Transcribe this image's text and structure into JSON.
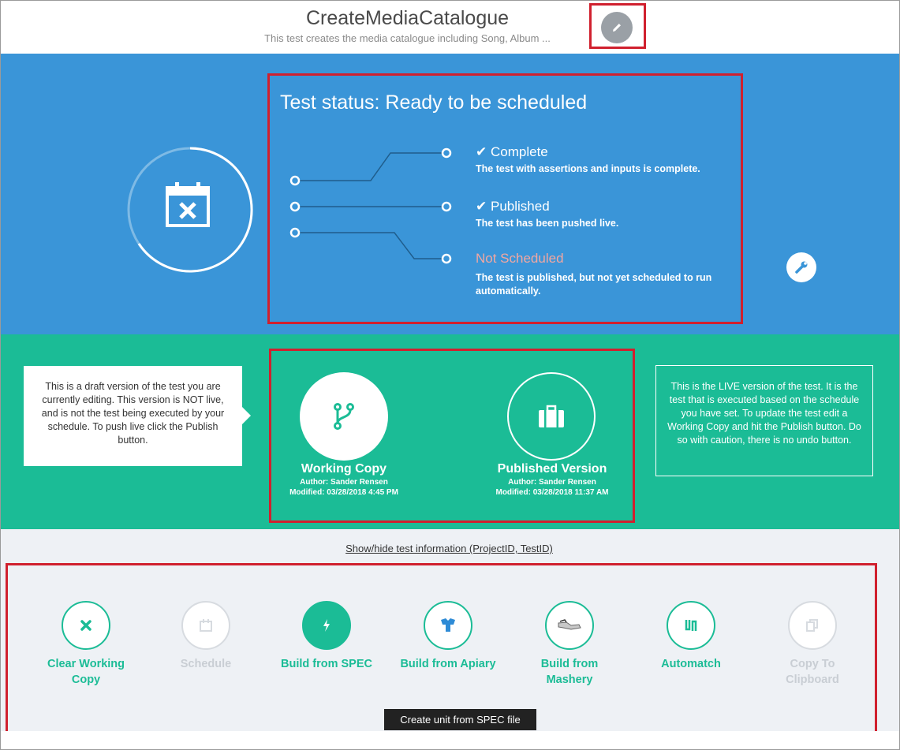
{
  "header": {
    "title": "CreateMediaCatalogue",
    "subtitle": "This test creates the media catalogue including Song, Album ..."
  },
  "status": {
    "title": "Test status: Ready to be scheduled",
    "steps": [
      {
        "label": "Complete",
        "desc": "The test with assertions and inputs is complete.",
        "checked": true
      },
      {
        "label": "Published",
        "desc": "The test has been pushed live.",
        "checked": true
      },
      {
        "label": "Not Scheduled",
        "desc1": "The test is published, but not yet scheduled to run",
        "desc2": "automatically.",
        "checked": false
      }
    ],
    "check_glyph": "✔",
    "colors": {
      "band": "#3a95d8",
      "warn": "#f2a7a1"
    }
  },
  "versions": {
    "draft_note": "This is a draft version of the test you are currently editing. This version is NOT live, and is not the test being executed by your schedule. To push live click the Publish button.",
    "live_note": "This is the LIVE version of the test. It is the test that is executed based on the schedule you have set. To update the test edit a Working Copy and hit the Publish button. Do so with caution, there is no undo button.",
    "working": {
      "title": "Working Copy",
      "author": "Author: Sander Rensen",
      "modified": "Modified: 03/28/2018 4:45 PM",
      "icon": "git-branch-icon"
    },
    "published": {
      "title": "Published Version",
      "author": "Author: Sander Rensen",
      "modified": "Modified: 03/28/2018 11:37 AM",
      "icon": "briefcase-icon"
    },
    "colors": {
      "band": "#1bbc96"
    }
  },
  "actions": {
    "toggle_info": "Show/hide test information (ProjectID, TestID)",
    "items": [
      {
        "line1": "Clear Working",
        "line2": "Copy",
        "icon": "close-icon",
        "state": "enabled"
      },
      {
        "line1": "Schedule",
        "line2": "",
        "icon": "calendar-icon",
        "state": "disabled"
      },
      {
        "line1": "Build from SPEC",
        "line2": "",
        "icon": "lightning-icon",
        "state": "active"
      },
      {
        "line1": "Build from Apiary",
        "line2": "",
        "icon": "apiary-icon",
        "state": "enabled"
      },
      {
        "line1": "Build from",
        "line2": "Mashery",
        "icon": "mashery-icon",
        "state": "enabled"
      },
      {
        "line1": "Automatch",
        "line2": "",
        "icon": "automatch-icon",
        "state": "enabled"
      },
      {
        "line1": "Copy To",
        "line2": "Clipboard",
        "icon": "copy-icon",
        "state": "disabled"
      }
    ],
    "tooltip": "Create unit from SPEC file"
  }
}
